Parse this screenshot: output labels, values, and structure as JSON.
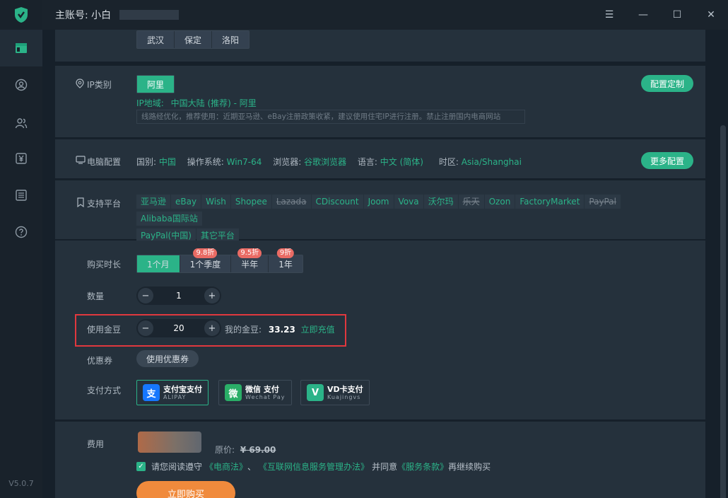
{
  "window": {
    "account_label": "主账号: 小白"
  },
  "version": "V5.0.7",
  "city_tags": [
    "武汉",
    "保定",
    "洛阳"
  ],
  "ip_section": {
    "label": "IP类别",
    "type_btn": "阿里",
    "region_prefix": "IP地域:",
    "region_value": "中国大陆 (推荐) - 阿里",
    "note": "线路经优化，推荐使用：近期亚马逊、eBay注册政策收紧，建议使用住宅IP进行注册。禁止注册国内电商网站",
    "config_btn": "配置定制"
  },
  "pc_config": {
    "label": "电脑配置",
    "country_key": "国别:",
    "country_val": "中国",
    "os_key": "操作系统:",
    "os_val": "Win7-64",
    "browser_key": "浏览器:",
    "browser_val": "谷歌浏览器",
    "lang_key": "语言:",
    "lang_val": "中文 (简体)",
    "tz_key": "时区:",
    "tz_val": "Asia/Shanghai",
    "more_btn": "更多配置"
  },
  "platforms": {
    "label": "支持平台",
    "row1": [
      {
        "name": "亚马逊",
        "on": true
      },
      {
        "name": "eBay",
        "on": true
      },
      {
        "name": "Wish",
        "on": true
      },
      {
        "name": "Shopee",
        "on": true
      },
      {
        "name": "Lazada",
        "on": false
      },
      {
        "name": "CDiscount",
        "on": true
      },
      {
        "name": "Joom",
        "on": true
      },
      {
        "name": "Vova",
        "on": true
      },
      {
        "name": "沃尔玛",
        "on": true
      },
      {
        "name": "乐天",
        "on": false
      },
      {
        "name": "Ozon",
        "on": true
      },
      {
        "name": "FactoryMarket",
        "on": true
      },
      {
        "name": "PayPal",
        "on": false
      },
      {
        "name": "Alibaba国际站",
        "on": true
      }
    ],
    "row2": [
      {
        "name": "PayPal(中国)",
        "on": true
      },
      {
        "name": "其它平台",
        "on": true
      }
    ]
  },
  "purchase": {
    "duration_label": "购买时长",
    "durations": [
      {
        "label": "1个月",
        "badge": "",
        "selected": true
      },
      {
        "label": "1个季度",
        "badge": "9.8折",
        "selected": false
      },
      {
        "label": "半年",
        "badge": "9.5折",
        "selected": false
      },
      {
        "label": "1年",
        "badge": "9折",
        "selected": false
      }
    ],
    "qty_label": "数量",
    "qty_value": "1",
    "beans_label": "使用金豆",
    "beans_value": "20",
    "my_beans_label": "我的金豆:",
    "my_beans_value": "33.23",
    "recharge_link": "立即充值",
    "coupon_label": "优惠券",
    "coupon_btn": "使用优惠券",
    "payment_label": "支付方式",
    "payments": [
      {
        "title": "支付宝支付",
        "sub": "ALIPAY",
        "icon": "支",
        "color": "#1677ff",
        "selected": true
      },
      {
        "title": "微信 支付",
        "sub": "Wechat Pay",
        "icon": "微",
        "color": "#2aae67",
        "selected": false
      },
      {
        "title": "VD卡支付",
        "sub": "Kuajingvs",
        "icon": "V",
        "color": "#2bb388",
        "selected": false
      }
    ]
  },
  "fee": {
    "label": "费用",
    "original_label": "原价:",
    "original_price": "¥ 69.00",
    "agree_prefix": "请您阅读遵守",
    "law1": "《电商法》",
    "sep": "、",
    "law2": "《互联网信息服务管理办法》",
    "agree_mid": "并同意",
    "terms": "《服务条款》",
    "agree_suffix": "再继续购买",
    "buy_btn": "立即购买"
  },
  "colors": {
    "accent": "#2bb388",
    "highlight": "#e0383e",
    "badge": "#e96b64",
    "buy": "#f08a3c"
  }
}
